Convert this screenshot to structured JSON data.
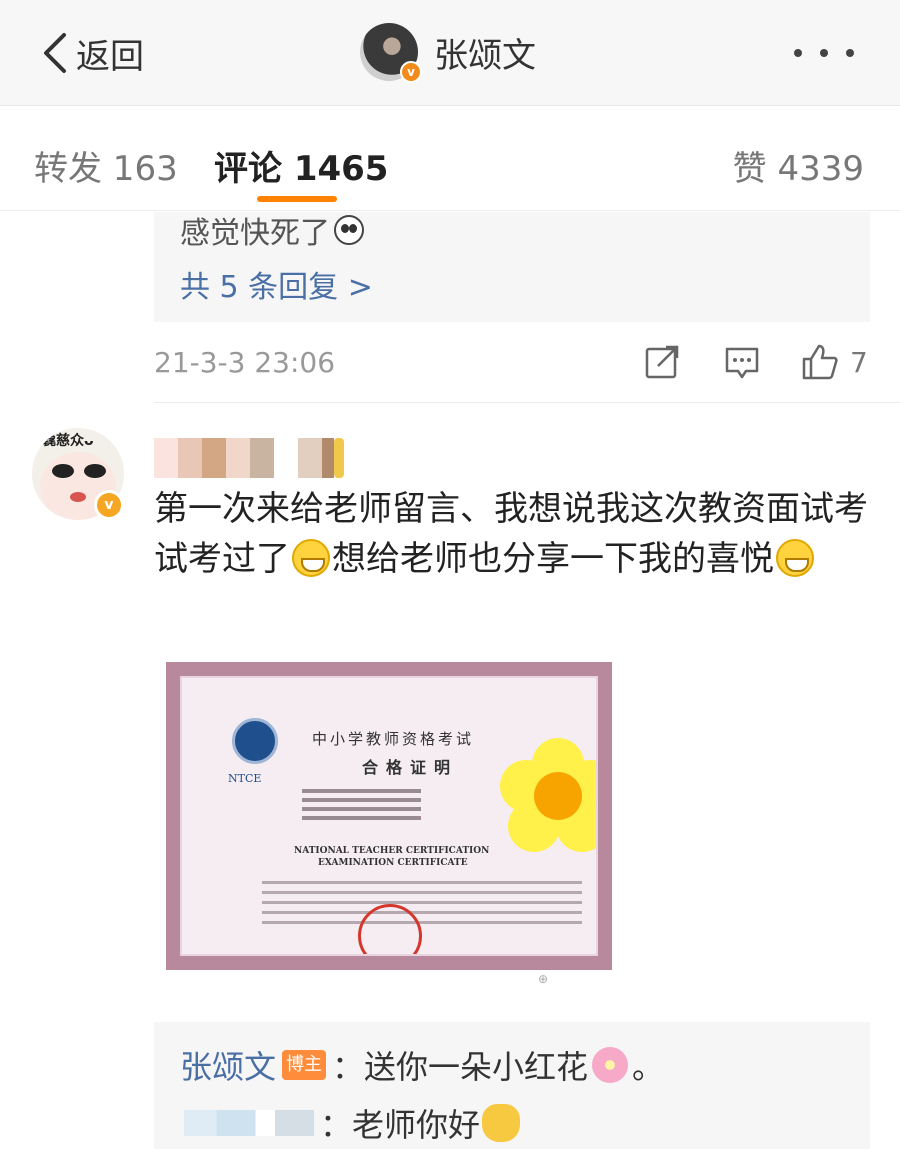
{
  "topbar": {
    "back_label": "返回",
    "title": "张颂文",
    "verified_mark": "v"
  },
  "tabs": {
    "repost": "转发 163",
    "comment": "评论 1465",
    "like": "赞 4339"
  },
  "previous_comment": {
    "text_tail": "感觉快死了",
    "more_replies": "共 5 条回复 >",
    "time": "21-3-3 23:06",
    "like_count": "7"
  },
  "comment": {
    "avatar_caption": "毳慈众ᴗ",
    "verified_mark": "v",
    "text_1": "第一次来给老师留言、我想说我这次教资面试考试考过了",
    "text_2": "想给老师也分享一下我的喜悦",
    "certificate": {
      "org_cn": "中小学教师资格考试",
      "title_cn": "合格证明",
      "logo_text": "NTCE",
      "title_en_1": "NATIONAL TEACHER CERTIFICATION",
      "title_en_2": "EXAMINATION CERTIFICATE"
    }
  },
  "replies": {
    "author_reply": {
      "author": "张颂文",
      "tag": "博主",
      "text": "：送你一朵小红花",
      "end": "。"
    },
    "user_reply": {
      "text": "：老师你好"
    }
  },
  "colors": {
    "accent": "#ff8200",
    "link": "#4a6fa5"
  }
}
